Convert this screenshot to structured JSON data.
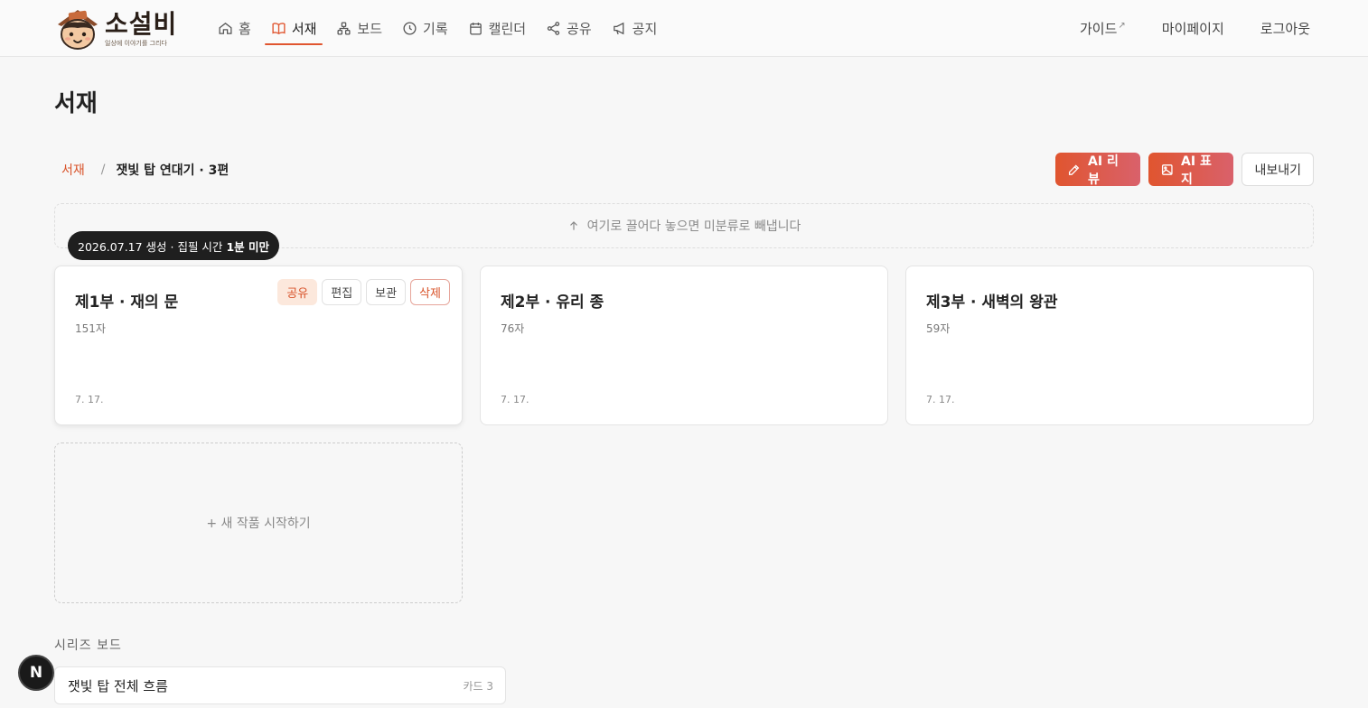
{
  "brand": {
    "name": "소설비",
    "tagline": "일상에 이야기를 그리다"
  },
  "nav": {
    "items": [
      {
        "label": "홈",
        "icon": "home-icon"
      },
      {
        "label": "서재",
        "icon": "book-icon",
        "active": true
      },
      {
        "label": "보드",
        "icon": "board-icon"
      },
      {
        "label": "기록",
        "icon": "clock-icon"
      },
      {
        "label": "캘린더",
        "icon": "calendar-icon"
      },
      {
        "label": "공유",
        "icon": "share-icon"
      },
      {
        "label": "공지",
        "icon": "megaphone-icon"
      }
    ],
    "right": {
      "guide": "가이드",
      "guide_mark": "↗",
      "mypage": "마이페이지",
      "logout": "로그아웃"
    }
  },
  "page": {
    "title": "서재"
  },
  "breadcrumb": {
    "root": "서재",
    "separator": "/",
    "current": "잿빛 탑 연대기 · 3편"
  },
  "actions": {
    "ai_review": "AI 리뷰",
    "ai_cover": "AI 표지",
    "export": "내보내기"
  },
  "dropzone": {
    "icon": "arrow-up-icon",
    "text": "여기로 끌어다 놓으면 미분류로 빼냅니다"
  },
  "tooltip": {
    "text": "2026.07.17 생성 · 집필 시간",
    "emphasis": "1분 미만"
  },
  "cards": [
    {
      "title": "제1부 · 재의 문",
      "count": "151자",
      "date": "7. 17."
    },
    {
      "title": "제2부 · 유리 종",
      "count": "76자",
      "date": "7. 17."
    },
    {
      "title": "제3부 · 새벽의 왕관",
      "count": "59자",
      "date": "7. 17."
    }
  ],
  "card_tools": {
    "share": "공유",
    "edit": "편집",
    "archive": "보관",
    "delete": "삭제"
  },
  "new_card": {
    "label": "+ 새 작품 시작하기"
  },
  "series_board": {
    "label": "시리즈 보드",
    "rows": [
      {
        "title": "잿빛 탑 전체 흐름",
        "count": "카드 3"
      }
    ]
  },
  "fab": {
    "label": "N"
  },
  "colors": {
    "accent": "#e0552f",
    "accent_end": "#d9616b",
    "tooltip_bg": "#1f1f1f"
  }
}
